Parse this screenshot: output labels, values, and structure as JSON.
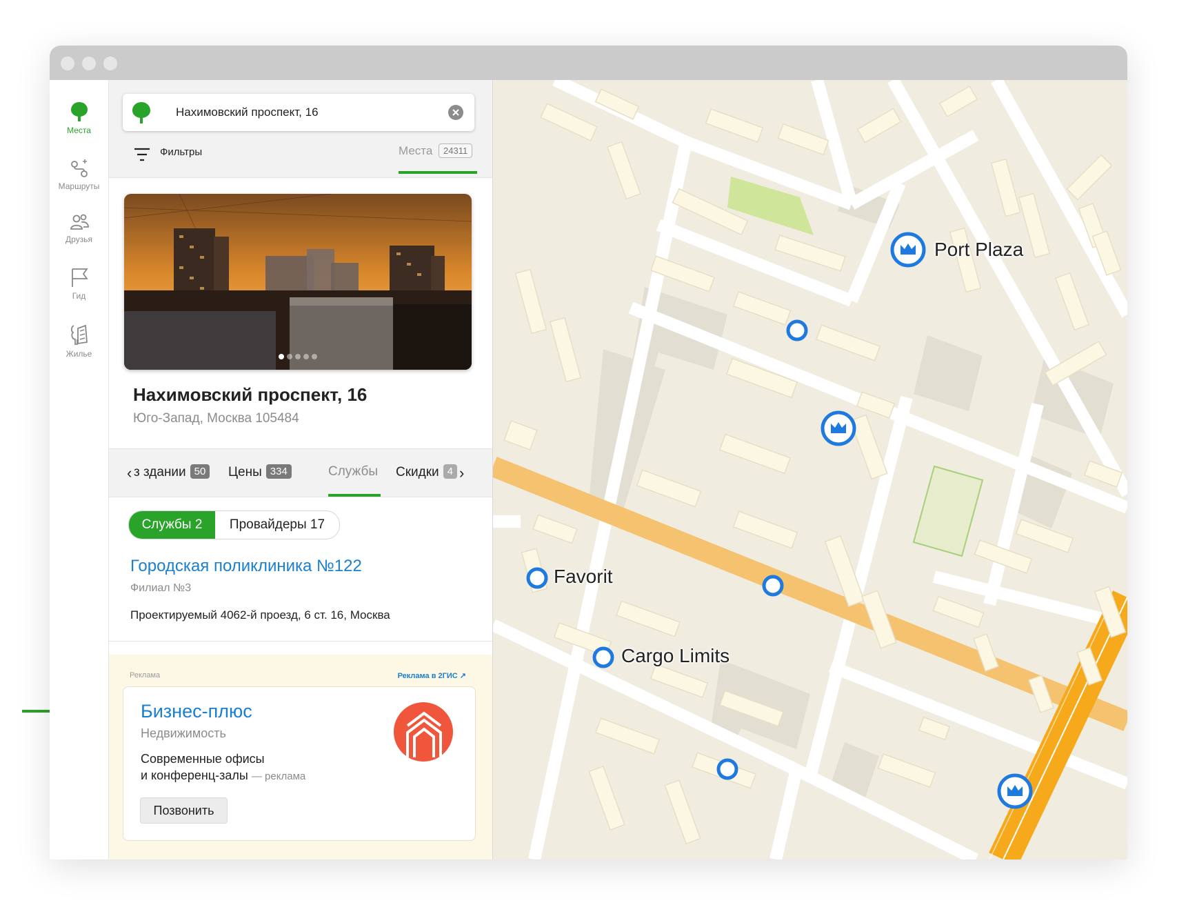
{
  "colors": {
    "brand_green": "#29a329",
    "link_blue": "#1a7fcf",
    "poi_blue": "#1f7ae0",
    "map_background": "#f0ecdf",
    "building": "#fbf7e3",
    "highway": "#f6c877",
    "ad_background": "#fdf7e6",
    "ad_logo": "#f0563c"
  },
  "sidebar": {
    "items": [
      {
        "label": "Места",
        "icon": "place-pin-icon",
        "active": true
      },
      {
        "label": "Маршруты",
        "icon": "route-icon",
        "active": false
      },
      {
        "label": "Друзья",
        "icon": "friends-icon",
        "active": false
      },
      {
        "label": "Гид",
        "icon": "guide-flag-icon",
        "active": false
      },
      {
        "label": "Жилье",
        "icon": "housing-icon",
        "active": false
      }
    ]
  },
  "search": {
    "value": "Нахимовский проспект, 16",
    "logo_icon": "2gis-logo-icon",
    "clear_icon": "clear-icon"
  },
  "toolbar": {
    "filters_label": "Фильтры",
    "filters_icon": "filter-icon",
    "places_tab_label": "Места",
    "places_count": "24311"
  },
  "place_card": {
    "photo_slides": 5,
    "active_slide": 1,
    "title": "Нахимовский проспект, 16",
    "subtitle": "Юго-Запад, Москва 105484"
  },
  "info_tabs": {
    "items": [
      {
        "label": "В здании",
        "visible_label": "з здании",
        "count": "50",
        "active": false
      },
      {
        "label": "Цены",
        "count": "334",
        "active": false
      },
      {
        "label": "Службы",
        "count": "",
        "active": true
      },
      {
        "label": "Скидки",
        "count": "4",
        "active": false
      }
    ]
  },
  "segments": {
    "primary": "Службы 2",
    "secondary": "Провайдеры 17"
  },
  "organization": {
    "name": "Городская поликлиника №122",
    "branch": "Филиал №3",
    "address": "Проектируемый 4062-й проезд, 6 ст. 16, Москва"
  },
  "advertisement": {
    "label": "Реклама",
    "link": "Реклама в 2ГИС ↗",
    "name": "Бизнес-плюс",
    "category": "Недвижимость",
    "description_line1": "Современные офисы",
    "description_line2": "и конференц-залы",
    "note": "— реклама",
    "call_button": "Позвонить"
  },
  "map": {
    "poi": [
      {
        "label": "Port Plaza",
        "type": "crown"
      },
      {
        "label": "Favorit",
        "type": "circle"
      },
      {
        "label": "Cargo Limits",
        "type": "circle"
      }
    ],
    "unlabeled_markers": [
      {
        "type": "circle"
      },
      {
        "type": "crown"
      },
      {
        "type": "circle"
      },
      {
        "type": "circle"
      },
      {
        "type": "crown"
      }
    ]
  }
}
